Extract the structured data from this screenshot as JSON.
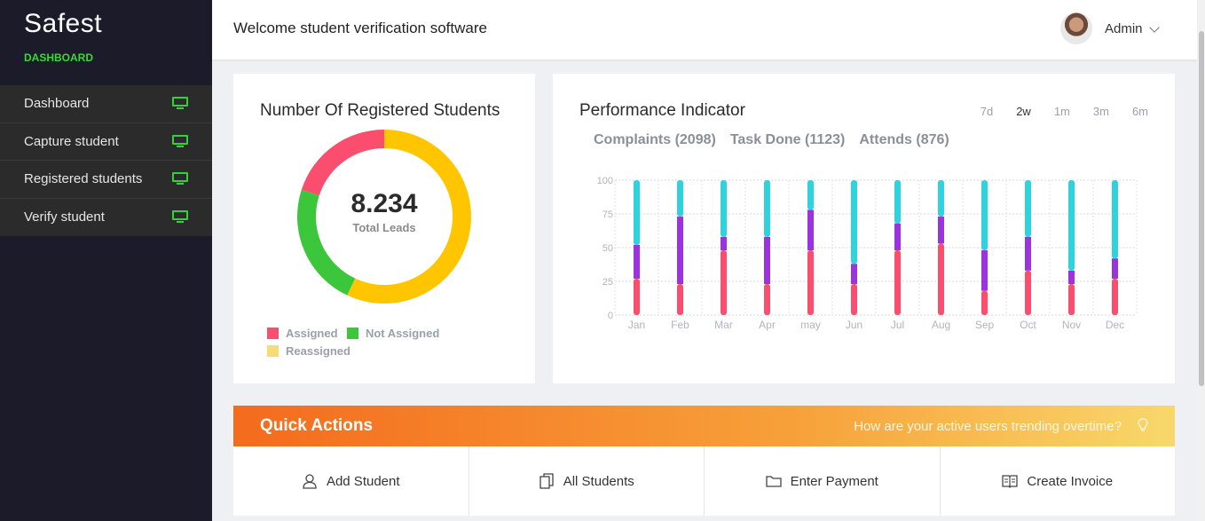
{
  "sidebar": {
    "brand": "Safest",
    "section_label": "DASHBOARD",
    "items": [
      {
        "label": "Dashboard",
        "icon": "monitor-icon"
      },
      {
        "label": "Capture student",
        "icon": "monitor-icon"
      },
      {
        "label": "Registered students",
        "icon": "monitor-icon"
      },
      {
        "label": "Verify student",
        "icon": "monitor-icon"
      }
    ],
    "accent_color": "#34d13a"
  },
  "header": {
    "welcome": "Welcome student verification software",
    "user_name": "Admin"
  },
  "donut_card": {
    "title": "Number Of Registered Students",
    "value": "8.234",
    "subtitle": "Total Leads",
    "legend": [
      {
        "label": "Assigned",
        "color": "#fb4d6e"
      },
      {
        "label": "Not Assigned",
        "color": "#3cc63c"
      },
      {
        "label": "Reassigned",
        "color": "#f7dc75"
      }
    ]
  },
  "perf_card": {
    "title": "Performance Indicator",
    "tabs": [
      "7d",
      "2w",
      "1m",
      "3m",
      "6m"
    ],
    "active_tab": "2w",
    "stats": [
      "Complaints (2098)",
      "Task Done (1123)",
      "Attends (876)"
    ]
  },
  "quick_actions": {
    "title": "Quick Actions",
    "question": "How are your active users trending overtime?",
    "items": [
      {
        "label": "Add Student",
        "icon": "user-icon"
      },
      {
        "label": "All Students",
        "icon": "documents-icon"
      },
      {
        "label": "Enter Payment",
        "icon": "folder-icon"
      },
      {
        "label": "Create Invoice",
        "icon": "book-icon"
      }
    ]
  },
  "chart_data": [
    {
      "type": "pie",
      "categories": [
        "Reassigned",
        "Not Assigned",
        "Assigned"
      ],
      "values": [
        57,
        23,
        20
      ],
      "colors": [
        "#ffc600",
        "#3cc63c",
        "#fb4d6e"
      ]
    },
    {
      "type": "bar",
      "stacked": true,
      "categories": [
        "Jan",
        "Feb",
        "Mar",
        "Apr",
        "may",
        "Jun",
        "Jul",
        "Aug",
        "Sep",
        "Oct",
        "Nov",
        "Dec"
      ],
      "series": [
        {
          "values": [
            27,
            23,
            48,
            23,
            48,
            23,
            48,
            53,
            18,
            33,
            23,
            27
          ],
          "color": "#fb4d6e"
        },
        {
          "values": [
            25,
            50,
            10,
            35,
            30,
            15,
            20,
            20,
            30,
            25,
            10,
            15
          ],
          "color": "#9b34e0"
        },
        {
          "values": [
            48,
            27,
            42,
            42,
            22,
            62,
            32,
            27,
            52,
            42,
            67,
            58
          ],
          "color": "#2ed3de"
        }
      ],
      "yticks": [
        0,
        25,
        50,
        75,
        100
      ],
      "ylim": [
        0,
        100
      ],
      "grid": true
    }
  ]
}
